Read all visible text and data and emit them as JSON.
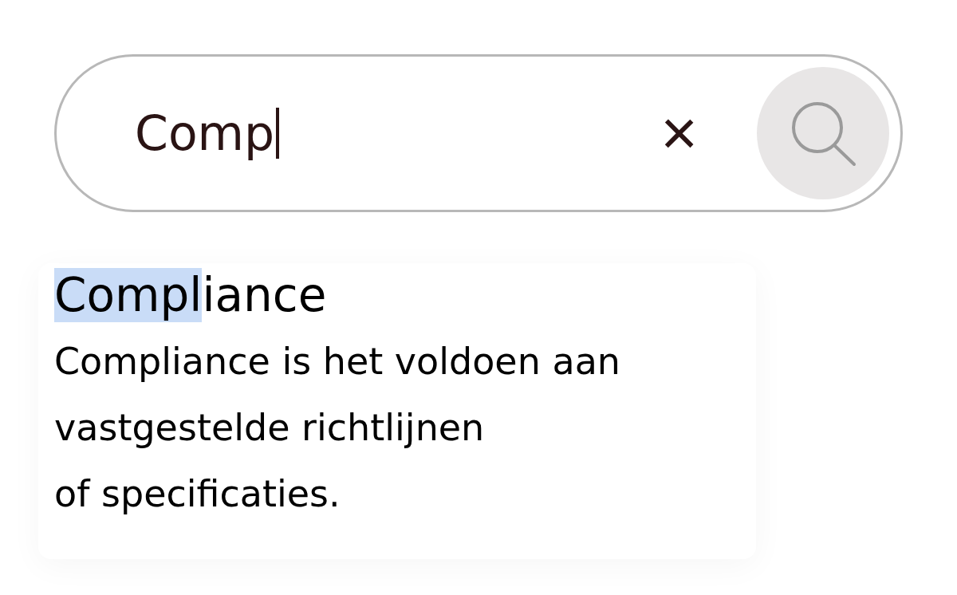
{
  "search": {
    "value": "Comp",
    "clear_label": "×"
  },
  "result": {
    "title_match": "Compl",
    "title_rest": "iance",
    "description_lines": [
      "Compliance is het voldoen aan",
      "vastgestelde richtlijnen",
      "of specificaties."
    ]
  }
}
